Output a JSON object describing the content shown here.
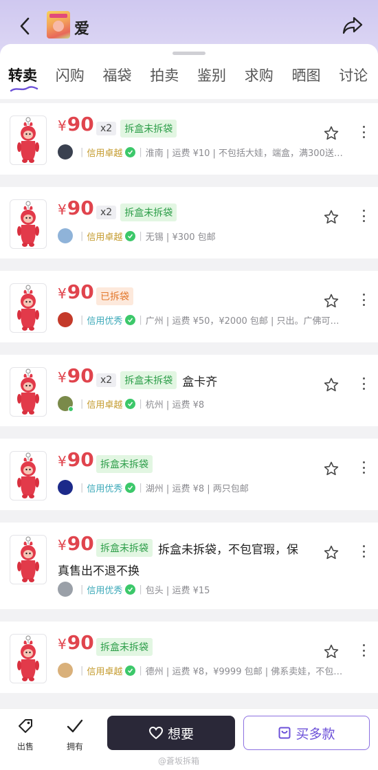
{
  "header": {
    "title": "爱",
    "back_icon": "chevron-left-icon",
    "share_icon": "share-icon",
    "background": "#d6cff2"
  },
  "tabs": [
    {
      "label": "转卖",
      "active": true
    },
    {
      "label": "闪购",
      "active": false
    },
    {
      "label": "福袋",
      "active": false
    },
    {
      "label": "拍卖",
      "active": false
    },
    {
      "label": "鉴别",
      "active": false
    },
    {
      "label": "求购",
      "active": false
    },
    {
      "label": "晒图",
      "active": false
    },
    {
      "label": "讨论",
      "active": false
    }
  ],
  "listings": [
    {
      "price_symbol": "¥",
      "price": "90",
      "qty": "x2",
      "condition": "拆盒未拆袋",
      "condition_color": "green",
      "extra": "",
      "extra2": "",
      "credit": "信用卓越",
      "credit_color": "#c49a2c",
      "meta": "淮南 | 运费 ¥10 | 不包括大娃，端盒，满300送…",
      "avatar_color": "#3a4150",
      "online": false
    },
    {
      "price_symbol": "¥",
      "price": "90",
      "qty": "x2",
      "condition": "拆盒未拆袋",
      "condition_color": "green",
      "extra": "",
      "extra2": "",
      "credit": "信用卓越",
      "credit_color": "#c49a2c",
      "meta": "无锡 | ¥300 包邮",
      "avatar_color": "#8fb3d9",
      "online": false
    },
    {
      "price_symbol": "¥",
      "price": "90",
      "qty": "",
      "condition": "已拆袋",
      "condition_color": "orange",
      "extra": "",
      "extra2": "",
      "credit": "信用优秀",
      "credit_color": "#3aa8b8",
      "meta": "广州 | 运费 ¥50，¥2000 包邮 | 只出。广佛可…",
      "avatar_color": "#c43a2a",
      "online": false
    },
    {
      "price_symbol": "¥",
      "price": "90",
      "qty": "x2",
      "condition": "拆盒未拆袋",
      "condition_color": "green",
      "extra": "盒卡齐",
      "extra2": "",
      "credit": "信用卓越",
      "credit_color": "#c49a2c",
      "meta": "杭州 | 运费 ¥8",
      "avatar_color": "#7a8a4a",
      "online": true
    },
    {
      "price_symbol": "¥",
      "price": "90",
      "qty": "",
      "condition": "拆盒未拆袋",
      "condition_color": "green",
      "extra": "",
      "extra2": "",
      "credit": "信用优秀",
      "credit_color": "#3aa8b8",
      "meta": "湖州 | 运费 ¥8 | 两只包邮",
      "avatar_color": "#1c2a8a",
      "online": false
    },
    {
      "price_symbol": "¥",
      "price": "90",
      "qty": "",
      "condition": "拆盒未拆袋",
      "condition_color": "green",
      "extra": "拆盒未拆袋，不包官瑕，保",
      "extra2": "真售出不退不换",
      "credit": "信用优秀",
      "credit_color": "#3aa8b8",
      "meta": "包头 | 运费 ¥15",
      "avatar_color": "#9aa0a8",
      "online": false
    },
    {
      "price_symbol": "¥",
      "price": "90",
      "qty": "",
      "condition": "拆盒未拆袋",
      "condition_color": "green",
      "extra": "",
      "extra2": "",
      "credit": "信用卓越",
      "credit_color": "#c49a2c",
      "meta": "德州 | 运费 ¥8，¥9999 包邮 | 佛系卖娃，不包…",
      "avatar_color": "#d9b07a",
      "online": false
    }
  ],
  "bottom_bar": {
    "sell_label": "出售",
    "own_label": "拥有",
    "want_label": "想要",
    "multi_label": "买多款"
  },
  "watermark": "@蒼坂拆箱",
  "colors": {
    "price": "#e0444d",
    "accent": "#6b4fd8",
    "dark_button": "#2a2838"
  }
}
